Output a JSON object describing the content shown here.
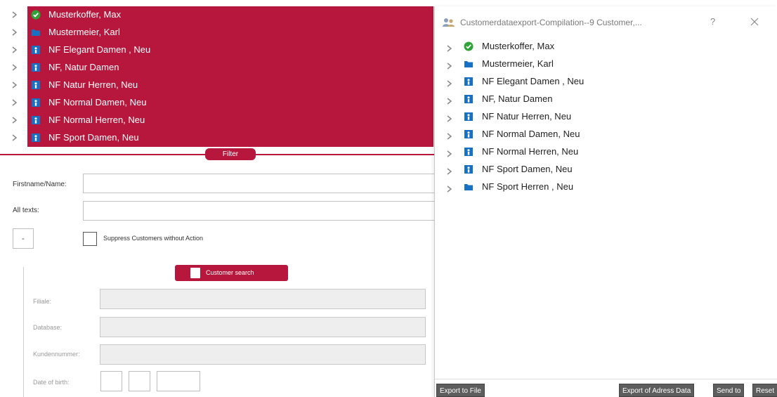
{
  "left_tree": {
    "items": [
      {
        "label": "Musterkoffer, Max",
        "icon": "check-circle-icon"
      },
      {
        "label": "Mustermeier, Karl",
        "icon": "folder-icon"
      },
      {
        "label": "NF Elegant Damen , Neu",
        "icon": "group-icon"
      },
      {
        "label": "NF, Natur Damen",
        "icon": "group-icon"
      },
      {
        "label": "NF Natur Herren, Neu",
        "icon": "group-icon"
      },
      {
        "label": "NF Normal Damen, Neu",
        "icon": "group-icon"
      },
      {
        "label": "NF Normal Herren, Neu",
        "icon": "group-icon"
      },
      {
        "label": "NF Sport Damen, Neu",
        "icon": "group-icon"
      }
    ],
    "highlight_color": "#b7173c"
  },
  "filter": {
    "label": "Filter",
    "firstname_label": "Firstname/Name:",
    "firstname_value": "",
    "alltexts_label": "All texts:",
    "alltexts_value": "",
    "dash_label": "-",
    "suppress_label": "Suppress Customers without Action",
    "search_button": "Customer search",
    "fields": {
      "filiale_label": "Filiale:",
      "database_label": "Database:",
      "kundennummer_label": "Kundennummer:",
      "dob_label": "Date of birth:"
    }
  },
  "dialog": {
    "title": "Customerdataexport-Compilation--9 Customer,...",
    "help_label": "?",
    "items": [
      {
        "label": "Musterkoffer, Max",
        "icon": "check-circle-icon"
      },
      {
        "label": "Mustermeier, Karl",
        "icon": "folder-icon"
      },
      {
        "label": "NF Elegant Damen , Neu",
        "icon": "group-icon"
      },
      {
        "label": "NF, Natur Damen",
        "icon": "group-icon"
      },
      {
        "label": "NF Natur Herren, Neu",
        "icon": "group-icon"
      },
      {
        "label": "NF Normal Damen, Neu",
        "icon": "group-icon"
      },
      {
        "label": "NF Normal Herren, Neu",
        "icon": "group-icon"
      },
      {
        "label": "NF Sport Damen, Neu",
        "icon": "group-icon"
      },
      {
        "label": "NF Sport Herren , Neu",
        "icon": "folder-icon"
      }
    ],
    "footer": {
      "export_file": "Export to File",
      "export_address": "Export of Adress Data",
      "send_to": "Send to",
      "reset": "Reset"
    }
  },
  "colors": {
    "accent": "#b7173c",
    "check_green": "#2fa335",
    "folder_blue": "#1670c4",
    "footer_button": "#5d5d5d"
  }
}
